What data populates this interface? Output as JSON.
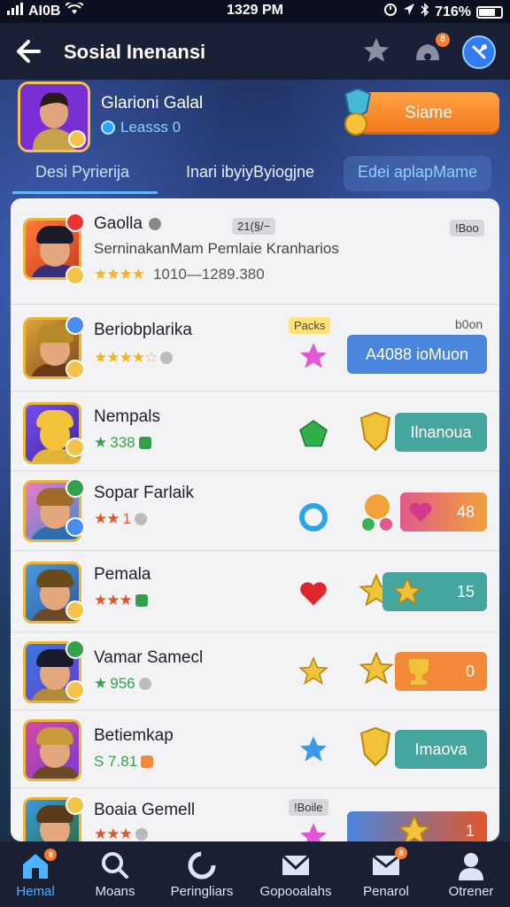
{
  "status_bar": {
    "carrier": "AI0B",
    "time": "1329 PM",
    "battery": "716%"
  },
  "header": {
    "title": "Sosial Inenansi",
    "notification_count": "8"
  },
  "profile": {
    "name": "Glarioni Galal",
    "subtitle": "Leasss 0",
    "start_button": "Siame"
  },
  "tabs": [
    {
      "label": "Desi Pyrierija",
      "active": true
    },
    {
      "label": "Inari ibyiyByiogjne",
      "active": false
    },
    {
      "label": "Edei aplapMame",
      "active": false
    }
  ],
  "rows": [
    {
      "name": "Gaolla",
      "tag": "21(§/−",
      "corner_tag": "!Boo",
      "description": "SerninakanMam Pemlaie Kranharios",
      "meta": "1010—1289.380",
      "stars": "★★★★"
    },
    {
      "name": "Beriobplarika",
      "tag": "Packs",
      "corner_tag": "b0on",
      "meta": "",
      "stars": "★★★★☆",
      "button": "A4088 ioMuon"
    },
    {
      "name": "Nempals",
      "meta": "338",
      "stars": "★",
      "button": "Ilnanoua"
    },
    {
      "name": "Sopar Farlaik",
      "meta": "1",
      "stars": "★★",
      "button": "48"
    },
    {
      "name": "Pemala",
      "meta": "",
      "stars": "★★★",
      "button": "15"
    },
    {
      "name": "Vamar Samecl",
      "meta": "956",
      "stars": "★",
      "button": "0"
    },
    {
      "name": "Betiemkap",
      "meta": "S 7.81",
      "stars": "",
      "button": "Imaova"
    },
    {
      "name": "Boaia Gemell",
      "tag": "!Boile",
      "meta": "",
      "stars": "★★★",
      "button": "1"
    }
  ],
  "bottom_nav": [
    {
      "label": "Hemal",
      "icon": "home-icon",
      "active": true,
      "badge": "8"
    },
    {
      "label": "Moans",
      "icon": "search-icon",
      "active": false
    },
    {
      "label": "Peringliars",
      "icon": "cycle-icon",
      "active": false
    },
    {
      "label": "Gopooalahs",
      "icon": "mail-icon",
      "active": false
    },
    {
      "label": "Penarol",
      "icon": "inbox-icon",
      "active": false,
      "badge": "8"
    },
    {
      "label": "Otrener",
      "icon": "profile-icon",
      "active": false
    }
  ],
  "colors": {
    "accent": "#2f7df0",
    "start_button": "#f58a2a",
    "teal_button": "#45a6a0",
    "blue_button": "#4b86dd",
    "orange_button": "#f28a3a"
  }
}
